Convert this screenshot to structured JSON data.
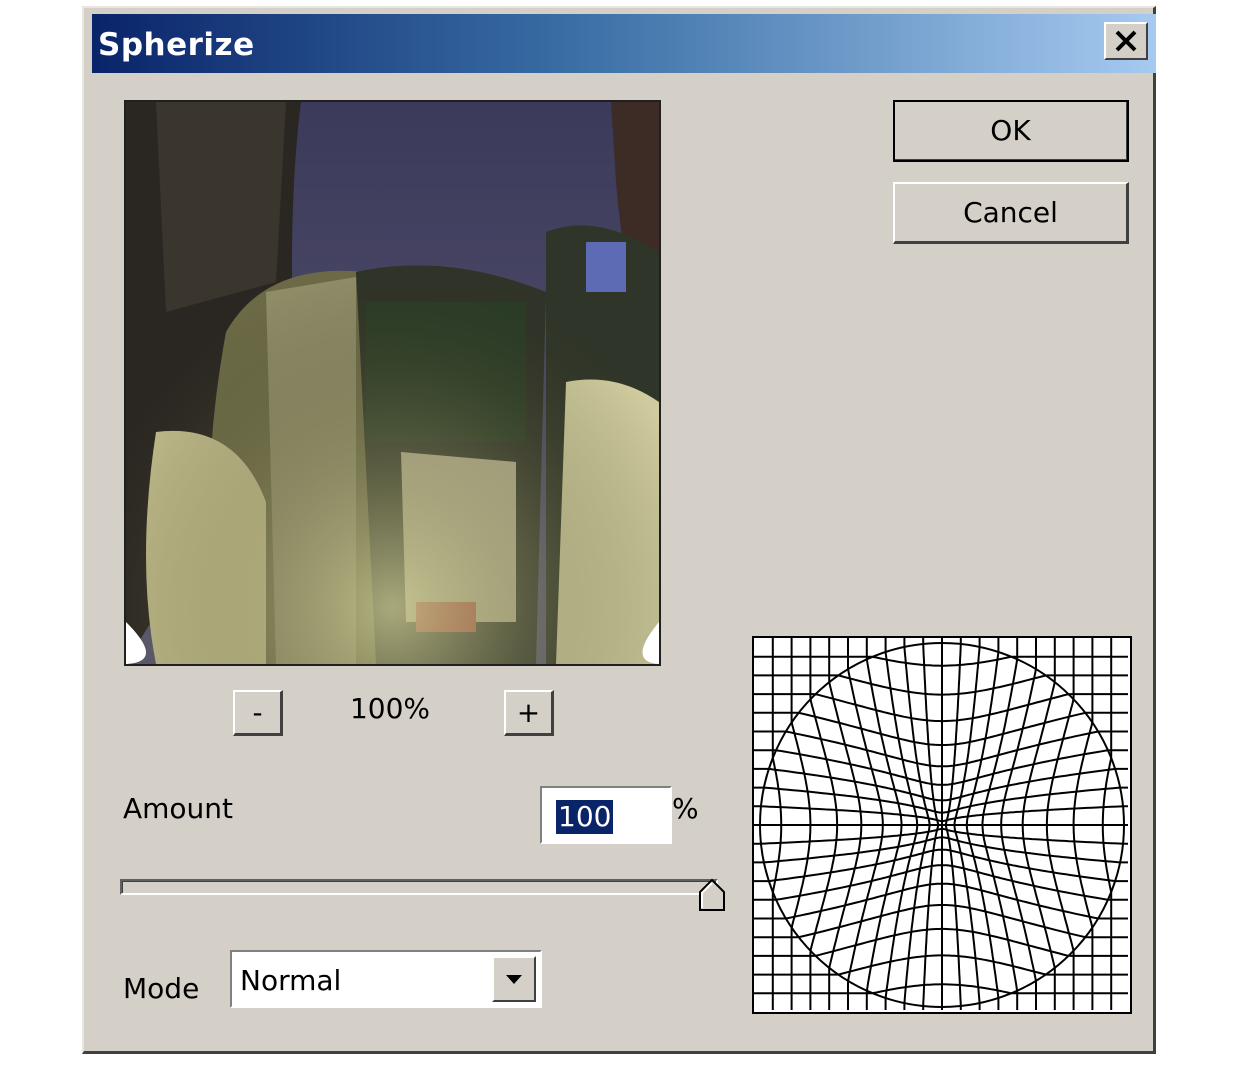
{
  "window": {
    "title": "Spherize",
    "close_symbol": "✕"
  },
  "buttons": {
    "ok": "OK",
    "cancel": "Cancel"
  },
  "zoom": {
    "minus": "-",
    "plus": "+",
    "level": "100%"
  },
  "amount": {
    "label": "Amount",
    "value": "100",
    "unit": "%",
    "slider_fraction": 1.0
  },
  "mode": {
    "label": "Mode",
    "value": "Normal"
  },
  "colors": {
    "face": "#d4d0c8",
    "title_start": "#0a246a",
    "title_end": "#a6caf0",
    "selection": "#0a246a"
  },
  "icons": {
    "close": "close-icon",
    "dropdown": "chevron-down-icon",
    "slider": "slider-thumb-icon"
  }
}
